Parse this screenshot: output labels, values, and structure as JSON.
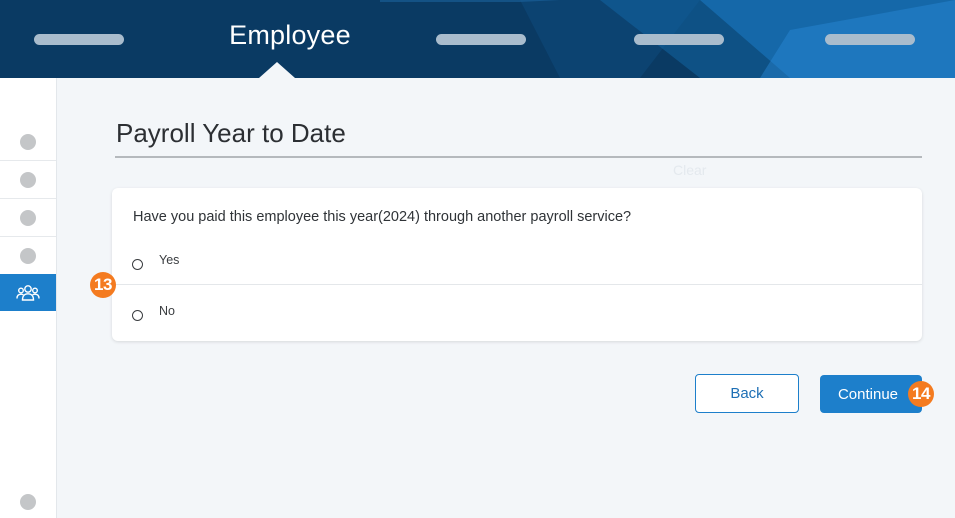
{
  "header": {
    "current_step": "Employee",
    "steps_hidden_count": 4
  },
  "sidebar": {
    "items": [
      {
        "icon": "step-dot-icon",
        "active": false
      },
      {
        "icon": "step-dot-icon",
        "active": false
      },
      {
        "icon": "step-dot-icon",
        "active": false
      },
      {
        "icon": "step-dot-icon",
        "active": false
      },
      {
        "icon": "people-icon",
        "active": true
      }
    ]
  },
  "main": {
    "title": "Payroll Year to Date",
    "faint_text": "Clear",
    "question": "Have you paid this employee this year(2024) through another payroll service?",
    "options": [
      {
        "label": "Yes",
        "selected": false
      },
      {
        "label": "No",
        "selected": false
      }
    ],
    "back_label": "Back",
    "continue_label": "Continue"
  },
  "annotations": {
    "badge_a": "13",
    "badge_b": "14"
  },
  "colors": {
    "header_bg": "#0a3a63",
    "accent": "#1d7fcb",
    "badge": "#f47b20"
  }
}
